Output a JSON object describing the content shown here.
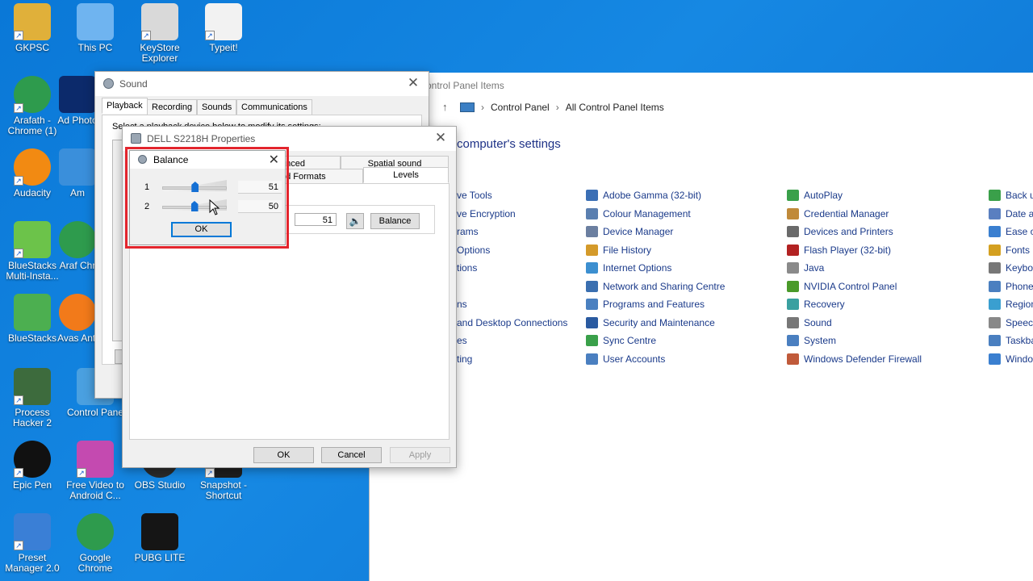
{
  "desktop": {
    "icons": [
      {
        "label": "GKPSC",
        "color": "#e0b03a"
      },
      {
        "label": "This PC",
        "color": "#6fb4f0"
      },
      {
        "label": "KeyStore Explorer",
        "color": "#d9d9d9"
      },
      {
        "label": "Typeit!",
        "color": "#f2f2f2"
      },
      {
        "label": "Arafath - Chrome (1)",
        "color": "#2e9b4d"
      },
      {
        "label": "Ad Photo",
        "color": "#0c2a6b"
      },
      {
        "label": "Audacity",
        "color": "#f28a12"
      },
      {
        "label": "Am",
        "color": "#3a8fdb"
      },
      {
        "label": "BlueStacks Multi-Insta...",
        "color": "#6cc34a"
      },
      {
        "label": "Araf Chr",
        "color": "#2e9b4d"
      },
      {
        "label": "BlueStacks",
        "color": "#4caf50"
      },
      {
        "label": "Avas Anti",
        "color": "#f27a1a"
      },
      {
        "label": "Process Hacker 2",
        "color": "#3d6b3d"
      },
      {
        "label": "Control Pane",
        "color": "#4aa0e0"
      },
      {
        "label": "Epic Pen",
        "color": "#111111"
      },
      {
        "label": "Free Video to Android C...",
        "color": "#c44ab0"
      },
      {
        "label": "OBS Studio",
        "color": "#2a2a2a"
      },
      {
        "label": "Snapshot - Shortcut",
        "color": "#1e1e1e"
      },
      {
        "label": "Preset Manager 2.0",
        "color": "#3a7fd6"
      },
      {
        "label": "Google Chrome",
        "color": "#2e9b4d"
      },
      {
        "label": "PUBG LITE",
        "color": "#151515"
      }
    ]
  },
  "control_panel": {
    "title_partial": "ontrol Panel Items",
    "breadcrumb": [
      "Control Panel",
      "All Control Panel Items"
    ],
    "heading_partial": "computer's settings",
    "col1": [
      "ve Tools",
      "ve Encryption",
      "rams",
      "Options",
      "tions",
      "",
      "ns",
      "and Desktop Connections",
      "es",
      "ting"
    ],
    "col2": [
      "Adobe Gamma (32-bit)",
      "Colour Management",
      "Device Manager",
      "File History",
      "Internet Options",
      "Network and Sharing Centre",
      "Programs and Features",
      "Security and Maintenance",
      "Sync Centre",
      "User Accounts"
    ],
    "col3": [
      "AutoPlay",
      "Credential Manager",
      "Devices and Printers",
      "Flash Player (32-bit)",
      "Java",
      "NVIDIA Control Panel",
      "Recovery",
      "Sound",
      "System",
      "Windows Defender Firewall"
    ],
    "col4": [
      "Back u",
      "Date a",
      "Ease o",
      "Fonts",
      "Keybo",
      "Phone",
      "Region",
      "Speech",
      "Taskba",
      "Windo"
    ],
    "icon_colors_col2": [
      "#3b6fb5",
      "#5a7fb0",
      "#6b7fa0",
      "#d49a2a",
      "#3c8fd0",
      "#3a6fb0",
      "#4a80c0",
      "#2a5aa0",
      "#3aa04a",
      "#4a7fc0"
    ],
    "icon_colors_col3": [
      "#3aa04a",
      "#c08a3a",
      "#6a6a6a",
      "#b22222",
      "#8a8a8a",
      "#4a9a2a",
      "#3aa0a0",
      "#777777",
      "#4a7fc0",
      "#c05a3a"
    ],
    "icon_colors_col4": [
      "#3aa04a",
      "#5a7fc0",
      "#3a7fd0",
      "#d4a020",
      "#777777",
      "#4a7fc0",
      "#3a9fd0",
      "#888888",
      "#4a7fc0",
      "#3a7fd0"
    ]
  },
  "sound_window": {
    "title": "Sound",
    "tabs": [
      "Playback",
      "Recording",
      "Sounds",
      "Communications"
    ],
    "instruction_partial": "Select a playback device below to modify its settings:"
  },
  "properties_window": {
    "title": "DELL S2218H Properties",
    "tabs_row1": [
      "anced",
      "Spatial sound"
    ],
    "tabs_row2": [
      "ed Formats",
      "Levels"
    ],
    "level_value": "51",
    "balance_button": "Balance",
    "ok": "OK",
    "cancel": "Cancel",
    "apply": "Apply"
  },
  "balance_dialog": {
    "title": "Balance",
    "channels": [
      {
        "label": "1",
        "value": "51",
        "level": 0.51
      },
      {
        "label": "2",
        "value": "50",
        "level": 0.5
      }
    ],
    "ok": "OK"
  }
}
